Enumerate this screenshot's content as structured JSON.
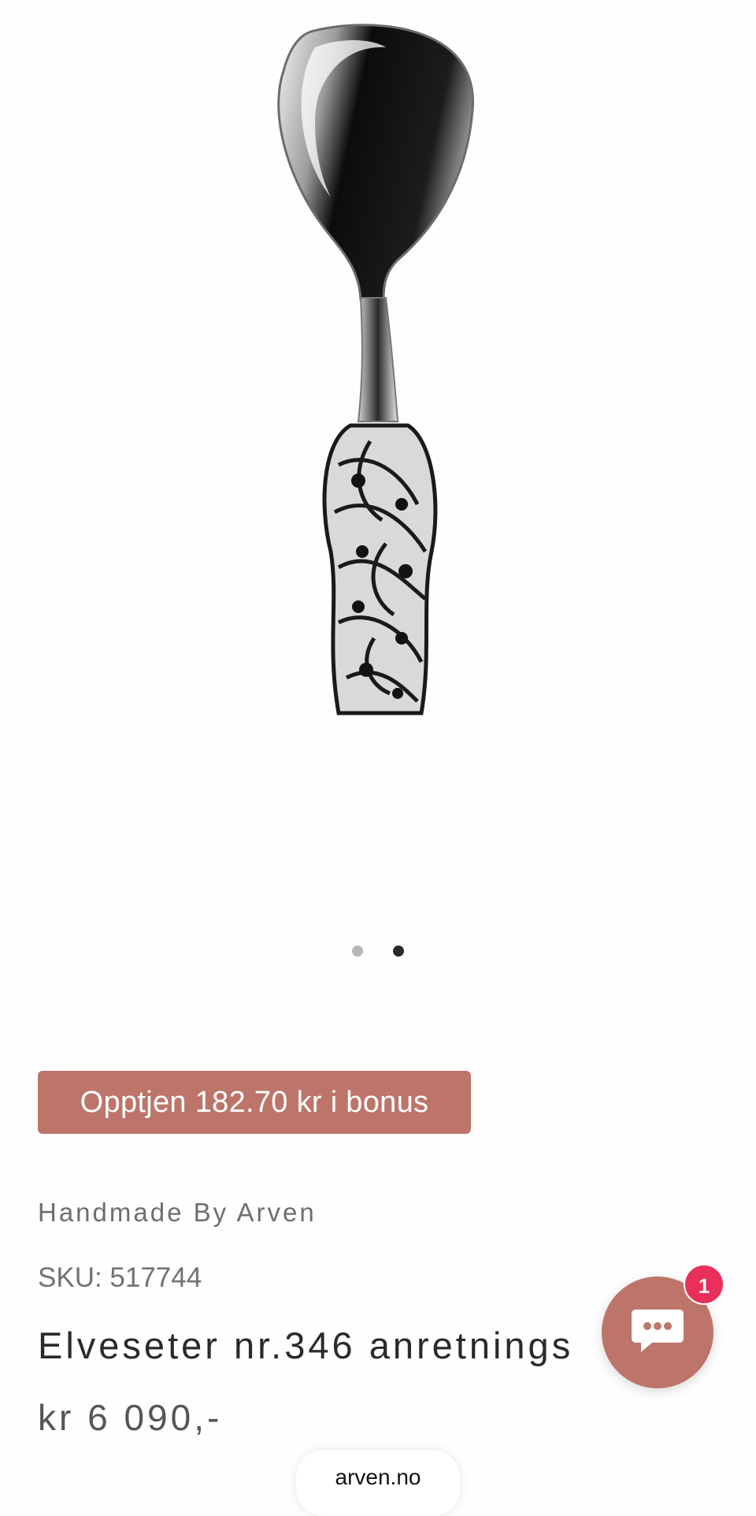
{
  "product": {
    "image_alt": "Elveseter nr.346 anretningsskje",
    "gallery_dots": 2,
    "active_dot": 2,
    "bonus_label": "Opptjen 182.70 kr i bonus",
    "vendor": "Handmade By Arven",
    "sku": "SKU: 517744",
    "title": "Elveseter nr.346 anretnings",
    "price": "kr 6 090,-"
  },
  "chat": {
    "badge_count": "1"
  },
  "browser": {
    "url": "arven.no"
  },
  "colors": {
    "accent": "#bd756a",
    "badge": "#e8305a"
  }
}
